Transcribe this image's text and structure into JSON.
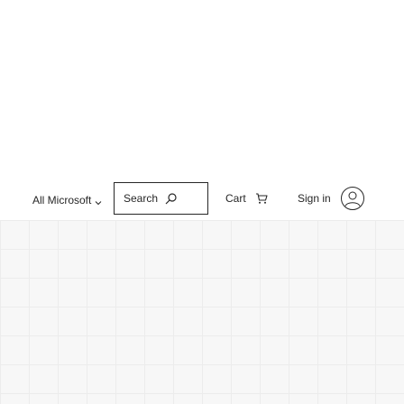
{
  "header": {
    "all_microsoft_label": "All Microsoft",
    "search_label": "Search",
    "cart_label": "Cart",
    "signin_label": "Sign in"
  },
  "icons": {
    "all_microsoft_chevron": "chevron-down-icon",
    "search": "search-icon",
    "cart": "cart-icon",
    "signin": "account-icon"
  },
  "colors": {
    "text": "#262626",
    "border": "#262626",
    "page_background": "#ffffff",
    "lower_background": "#f7f7f7"
  }
}
